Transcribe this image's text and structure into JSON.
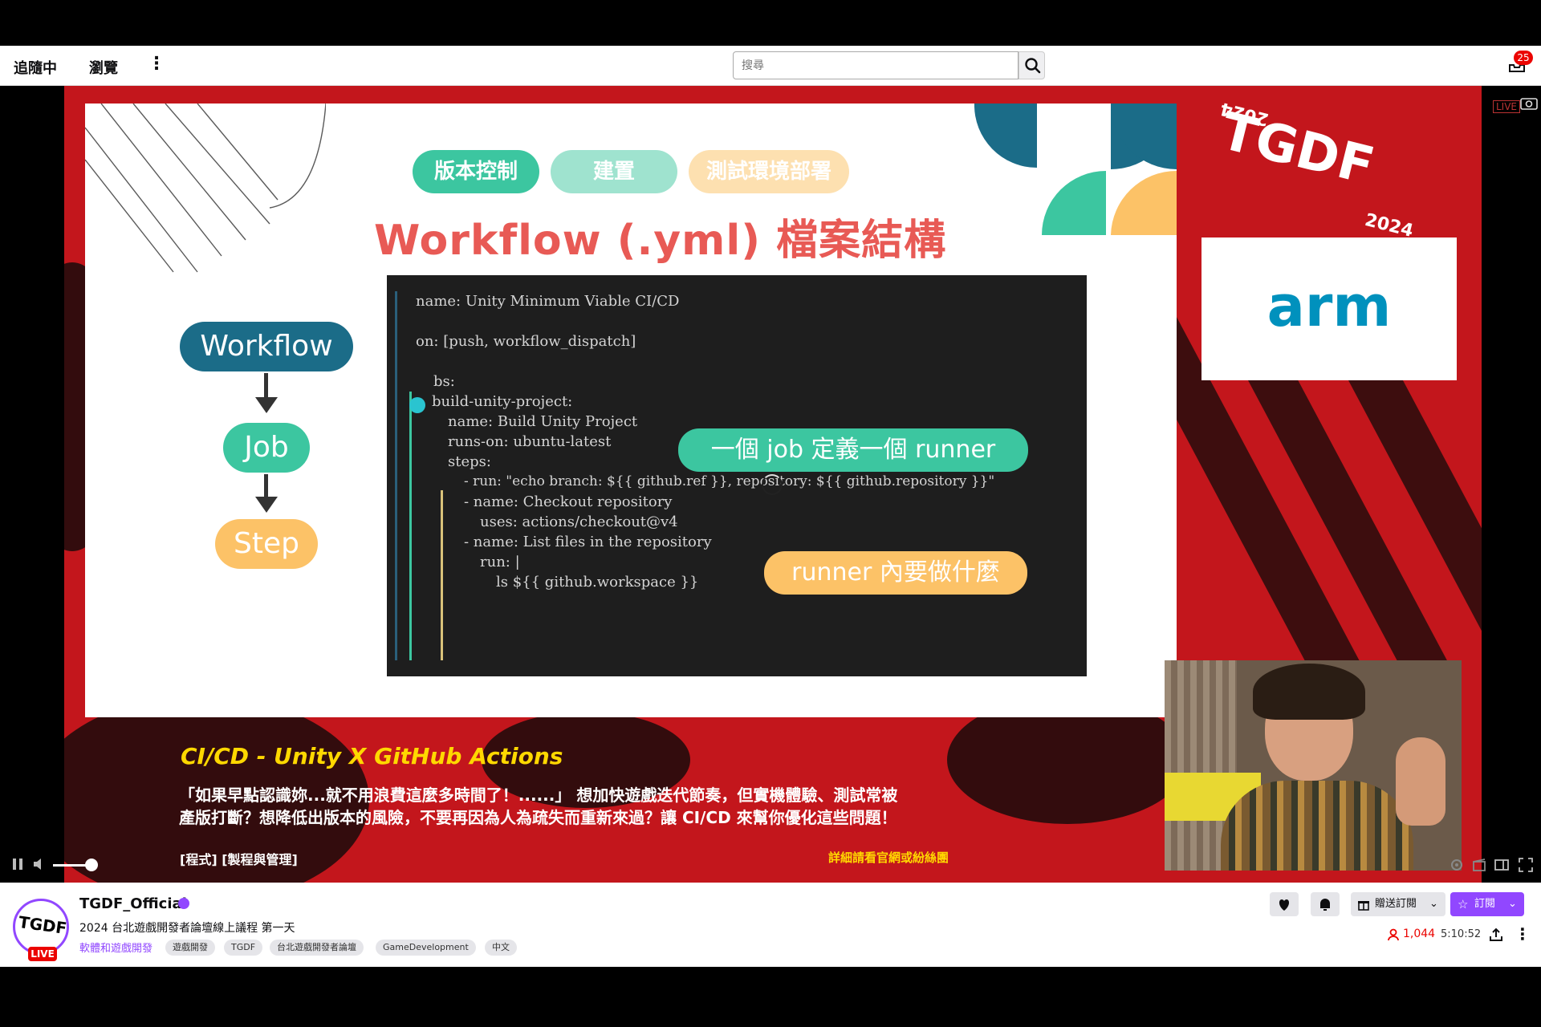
{
  "nav": {
    "following": "追隨中",
    "browse": "瀏覽",
    "more": "⋮",
    "search_placeholder": "搜尋",
    "notifications_count": "25"
  },
  "slide": {
    "pills": [
      "版本控制",
      "建置",
      "測試環境部署"
    ],
    "title": "Workflow (.yml) 檔案結構",
    "flow": [
      "Workflow",
      "Job",
      "Step"
    ],
    "code": [
      "name: Unity Minimum Viable CI/CD",
      "on: [push, workflow_dispatch]",
      "bs:",
      "build-unity-project:",
      "name: Build Unity Project",
      "runs-on: ubuntu-latest",
      "steps:",
      "- run: \"echo branch: ${{ github.ref }}, repository: ${{ github.repository }}\"",
      "- name: Checkout repository",
      "uses: actions/checkout@v4",
      "- name: List files in the repository",
      "run: |",
      "ls ${{ github.workspace }}"
    ],
    "bubble_job": "一個 job 定義一個 runner",
    "bubble_runner": "runner 內要做什麼"
  },
  "brand": {
    "event_logo_line1": "TGDF",
    "event_logo_line2": "2024",
    "event_logo_rev": "2024",
    "sponsor": "arm",
    "live_tag": "LIVE"
  },
  "overlay": {
    "session_title": "CI/CD - Unity X GitHub Actions",
    "description_line1": "「如果早點認識妳...就不用浪費這麼多時間了！......」 想加快遊戲迭代節奏，但實機體驗、測試常被",
    "description_line2": "產版打斷？想降低出版本的風險，不要再因為人為疏失而重新來過？讓 CI/CD 來幫你優化這些問題！",
    "category": "[程式] [製程與管理]",
    "more_info": "詳細請看官網或紛絲團"
  },
  "channel": {
    "avatar_text": "TGDF",
    "live_badge": "LIVE",
    "name": "TGDF_Official",
    "title": "2024 台北遊戲開發者論壇線上議程 第一天",
    "category": "軟體和遊戲開發",
    "tags": [
      "遊戲開發",
      "TGDF",
      "台北遊戲開發者論壇",
      "GameDevelopment",
      "中文"
    ],
    "gift_label": "贈送訂閱",
    "subscribe_label": "訂閱",
    "viewers": "1,044",
    "uptime": "5:10:52"
  },
  "colors": {
    "accent": "#9147ff",
    "live": "#eb0400",
    "stage_red": "#c3161c",
    "teal": "#3cc6a0",
    "navy": "#1b6c88",
    "amber": "#fcc267"
  }
}
